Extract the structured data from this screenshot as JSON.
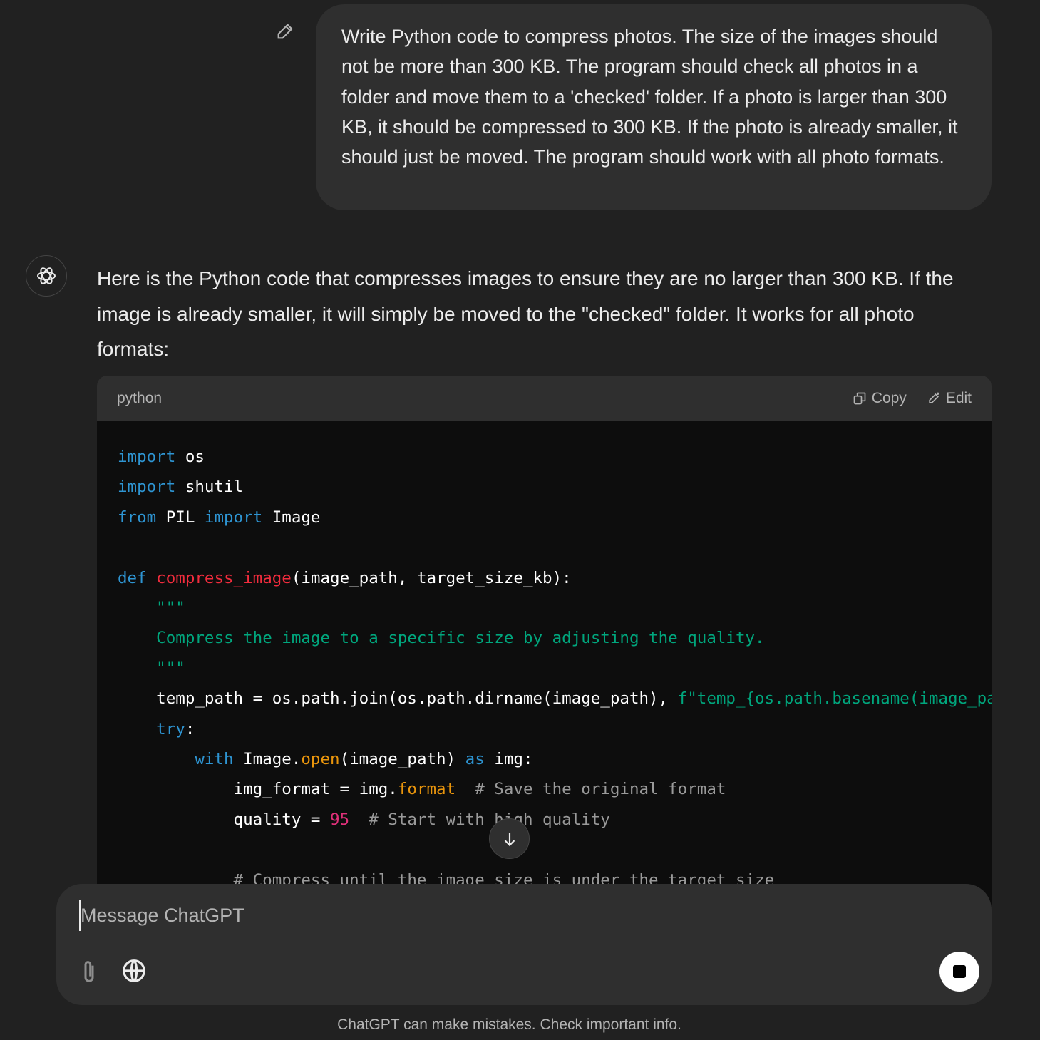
{
  "user_message": "Write Python code to compress photos. The size of the images should not be more than 300 KB. The program should check all photos in a folder and move them to a 'checked' folder. If a photo is larger than 300 KB, it should be compressed to 300 KB. If the photo is already smaller, it should just be moved. The program should work with all photo formats.",
  "assistant_message": "Here is the Python code that compresses images to ensure they are no larger than 300 KB. If the image is already smaller, it will simply be moved to the \"checked\" folder. It works for all photo formats:",
  "code_block": {
    "language": "python",
    "copy_label": "Copy",
    "edit_label": "Edit",
    "lines": [
      [
        [
          "k",
          "import"
        ],
        [
          "",
          "os"
        ]
      ],
      [
        [
          "k",
          "import"
        ],
        [
          "",
          "shutil"
        ]
      ],
      [
        [
          "k",
          "from"
        ],
        [
          "",
          "PIL"
        ],
        [
          "k",
          "import"
        ],
        [
          "",
          "Image"
        ]
      ],
      [],
      [
        [
          "k",
          "def"
        ],
        [
          "f",
          "compress_image"
        ],
        [
          "",
          "(image_path, target_size_kb):"
        ]
      ],
      [
        [
          "s",
          "    \"\"\""
        ]
      ],
      [
        [
          "s",
          "    Compress the image to a specific size by adjusting the quality."
        ]
      ],
      [
        [
          "s",
          "    \"\"\""
        ]
      ],
      [
        [
          "",
          "    temp_path = os.path.join(os.path.dirname(image_path), "
        ],
        [
          "s",
          "f\"temp_{os.path.basename(image_path)}\""
        ]
      ],
      [
        [
          "k",
          "    try"
        ],
        [
          "",
          ":"
        ]
      ],
      [
        [
          "k",
          "        with"
        ],
        [
          "",
          "Image."
        ],
        [
          "a",
          "open"
        ],
        [
          "",
          "(image_path)"
        ],
        [
          "k",
          "as"
        ],
        [
          "",
          "img:"
        ]
      ],
      [
        [
          "",
          "            img_format = img."
        ],
        [
          "a",
          "format"
        ],
        [
          "c",
          "  # Save the original format"
        ]
      ],
      [
        [
          "",
          "            quality = "
        ],
        [
          "m",
          "95"
        ],
        [
          "c",
          "  # Start with high quality"
        ]
      ],
      [],
      [
        [
          "c",
          "            # Compress until the image size is under the target size"
        ]
      ]
    ]
  },
  "composer": {
    "placeholder": "Message ChatGPT"
  },
  "footer": "ChatGPT can make mistakes. Check important info."
}
